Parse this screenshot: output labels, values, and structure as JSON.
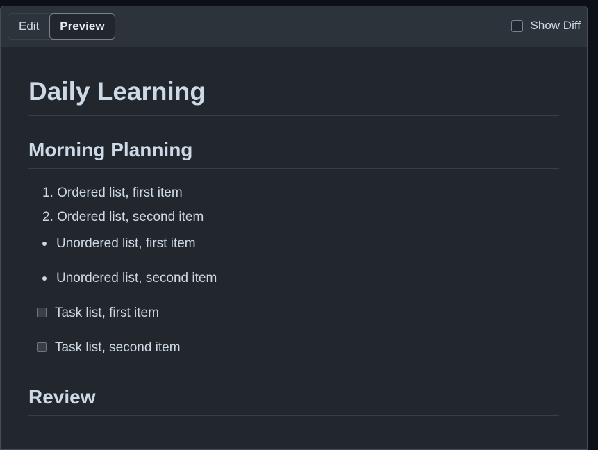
{
  "header": {
    "tabs": [
      {
        "label": "Edit",
        "active": false
      },
      {
        "label": "Preview",
        "active": true
      }
    ],
    "show_diff_label": "Show Diff"
  },
  "document": {
    "title": "Daily Learning",
    "sections": [
      {
        "heading": "Morning Planning",
        "ordered_list": [
          "1. Ordered list, first item",
          "2. Ordered list, second item"
        ],
        "unordered_list": [
          "Unordered list, first item",
          "Unordered list, second item"
        ],
        "task_list": [
          "Task list, first item",
          "Task list, second item"
        ]
      },
      {
        "heading": "Review"
      }
    ]
  },
  "colors": {
    "background": "#22272e",
    "header_background": "#2d333b",
    "text": "#cdd9e5",
    "border": "#444c56"
  }
}
